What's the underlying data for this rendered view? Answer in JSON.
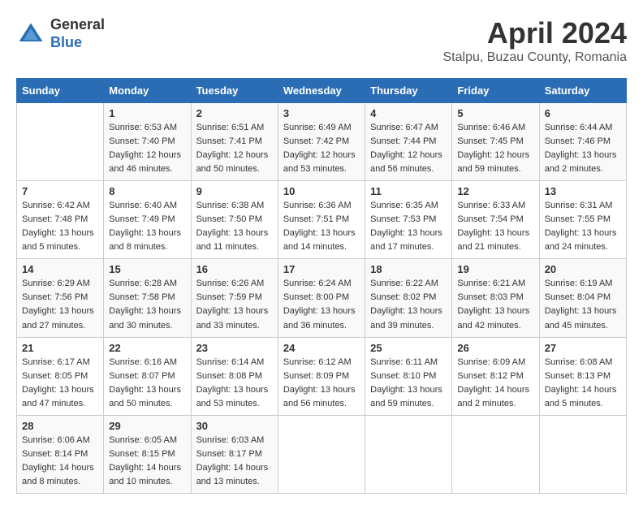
{
  "header": {
    "logo_general": "General",
    "logo_blue": "Blue",
    "month_year": "April 2024",
    "location": "Stalpu, Buzau County, Romania"
  },
  "weekdays": [
    "Sunday",
    "Monday",
    "Tuesday",
    "Wednesday",
    "Thursday",
    "Friday",
    "Saturday"
  ],
  "weeks": [
    [
      {
        "day": "",
        "info": ""
      },
      {
        "day": "1",
        "info": "Sunrise: 6:53 AM\nSunset: 7:40 PM\nDaylight: 12 hours\nand 46 minutes."
      },
      {
        "day": "2",
        "info": "Sunrise: 6:51 AM\nSunset: 7:41 PM\nDaylight: 12 hours\nand 50 minutes."
      },
      {
        "day": "3",
        "info": "Sunrise: 6:49 AM\nSunset: 7:42 PM\nDaylight: 12 hours\nand 53 minutes."
      },
      {
        "day": "4",
        "info": "Sunrise: 6:47 AM\nSunset: 7:44 PM\nDaylight: 12 hours\nand 56 minutes."
      },
      {
        "day": "5",
        "info": "Sunrise: 6:46 AM\nSunset: 7:45 PM\nDaylight: 12 hours\nand 59 minutes."
      },
      {
        "day": "6",
        "info": "Sunrise: 6:44 AM\nSunset: 7:46 PM\nDaylight: 13 hours\nand 2 minutes."
      }
    ],
    [
      {
        "day": "7",
        "info": "Sunrise: 6:42 AM\nSunset: 7:48 PM\nDaylight: 13 hours\nand 5 minutes."
      },
      {
        "day": "8",
        "info": "Sunrise: 6:40 AM\nSunset: 7:49 PM\nDaylight: 13 hours\nand 8 minutes."
      },
      {
        "day": "9",
        "info": "Sunrise: 6:38 AM\nSunset: 7:50 PM\nDaylight: 13 hours\nand 11 minutes."
      },
      {
        "day": "10",
        "info": "Sunrise: 6:36 AM\nSunset: 7:51 PM\nDaylight: 13 hours\nand 14 minutes."
      },
      {
        "day": "11",
        "info": "Sunrise: 6:35 AM\nSunset: 7:53 PM\nDaylight: 13 hours\nand 17 minutes."
      },
      {
        "day": "12",
        "info": "Sunrise: 6:33 AM\nSunset: 7:54 PM\nDaylight: 13 hours\nand 21 minutes."
      },
      {
        "day": "13",
        "info": "Sunrise: 6:31 AM\nSunset: 7:55 PM\nDaylight: 13 hours\nand 24 minutes."
      }
    ],
    [
      {
        "day": "14",
        "info": "Sunrise: 6:29 AM\nSunset: 7:56 PM\nDaylight: 13 hours\nand 27 minutes."
      },
      {
        "day": "15",
        "info": "Sunrise: 6:28 AM\nSunset: 7:58 PM\nDaylight: 13 hours\nand 30 minutes."
      },
      {
        "day": "16",
        "info": "Sunrise: 6:26 AM\nSunset: 7:59 PM\nDaylight: 13 hours\nand 33 minutes."
      },
      {
        "day": "17",
        "info": "Sunrise: 6:24 AM\nSunset: 8:00 PM\nDaylight: 13 hours\nand 36 minutes."
      },
      {
        "day": "18",
        "info": "Sunrise: 6:22 AM\nSunset: 8:02 PM\nDaylight: 13 hours\nand 39 minutes."
      },
      {
        "day": "19",
        "info": "Sunrise: 6:21 AM\nSunset: 8:03 PM\nDaylight: 13 hours\nand 42 minutes."
      },
      {
        "day": "20",
        "info": "Sunrise: 6:19 AM\nSunset: 8:04 PM\nDaylight: 13 hours\nand 45 minutes."
      }
    ],
    [
      {
        "day": "21",
        "info": "Sunrise: 6:17 AM\nSunset: 8:05 PM\nDaylight: 13 hours\nand 47 minutes."
      },
      {
        "day": "22",
        "info": "Sunrise: 6:16 AM\nSunset: 8:07 PM\nDaylight: 13 hours\nand 50 minutes."
      },
      {
        "day": "23",
        "info": "Sunrise: 6:14 AM\nSunset: 8:08 PM\nDaylight: 13 hours\nand 53 minutes."
      },
      {
        "day": "24",
        "info": "Sunrise: 6:12 AM\nSunset: 8:09 PM\nDaylight: 13 hours\nand 56 minutes."
      },
      {
        "day": "25",
        "info": "Sunrise: 6:11 AM\nSunset: 8:10 PM\nDaylight: 13 hours\nand 59 minutes."
      },
      {
        "day": "26",
        "info": "Sunrise: 6:09 AM\nSunset: 8:12 PM\nDaylight: 14 hours\nand 2 minutes."
      },
      {
        "day": "27",
        "info": "Sunrise: 6:08 AM\nSunset: 8:13 PM\nDaylight: 14 hours\nand 5 minutes."
      }
    ],
    [
      {
        "day": "28",
        "info": "Sunrise: 6:06 AM\nSunset: 8:14 PM\nDaylight: 14 hours\nand 8 minutes."
      },
      {
        "day": "29",
        "info": "Sunrise: 6:05 AM\nSunset: 8:15 PM\nDaylight: 14 hours\nand 10 minutes."
      },
      {
        "day": "30",
        "info": "Sunrise: 6:03 AM\nSunset: 8:17 PM\nDaylight: 14 hours\nand 13 minutes."
      },
      {
        "day": "",
        "info": ""
      },
      {
        "day": "",
        "info": ""
      },
      {
        "day": "",
        "info": ""
      },
      {
        "day": "",
        "info": ""
      }
    ]
  ]
}
